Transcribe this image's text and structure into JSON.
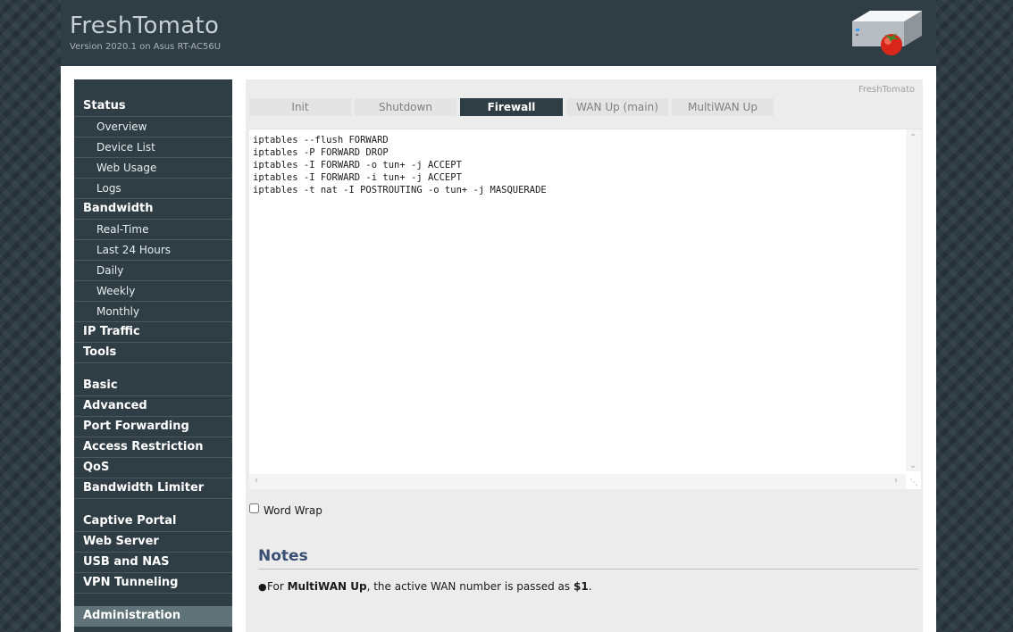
{
  "header": {
    "title": "FreshTomato",
    "version": "Version 2020.1 on Asus RT-AC56U"
  },
  "sidebar": {
    "items": [
      {
        "label": "Status",
        "type": "main"
      },
      {
        "label": "Overview",
        "type": "sub"
      },
      {
        "label": "Device List",
        "type": "sub"
      },
      {
        "label": "Web Usage",
        "type": "sub"
      },
      {
        "label": "Logs",
        "type": "sub"
      },
      {
        "label": "Bandwidth",
        "type": "main"
      },
      {
        "label": "Real-Time",
        "type": "sub"
      },
      {
        "label": "Last 24 Hours",
        "type": "sub"
      },
      {
        "label": "Daily",
        "type": "sub"
      },
      {
        "label": "Weekly",
        "type": "sub"
      },
      {
        "label": "Monthly",
        "type": "sub"
      },
      {
        "label": "IP Traffic",
        "type": "main"
      },
      {
        "label": "Tools",
        "type": "main"
      },
      {
        "label": "Basic",
        "type": "main"
      },
      {
        "label": "Advanced",
        "type": "main"
      },
      {
        "label": "Port Forwarding",
        "type": "main"
      },
      {
        "label": "Access Restriction",
        "type": "main"
      },
      {
        "label": "QoS",
        "type": "main"
      },
      {
        "label": "Bandwidth Limiter",
        "type": "main"
      },
      {
        "label": "Captive Portal",
        "type": "main"
      },
      {
        "label": "Web Server",
        "type": "main"
      },
      {
        "label": "USB and NAS",
        "type": "main"
      },
      {
        "label": "VPN Tunneling",
        "type": "main"
      },
      {
        "label": "Administration",
        "type": "main",
        "active": true
      }
    ]
  },
  "content": {
    "brand": "FreshTomato",
    "tabs": [
      {
        "label": "Init"
      },
      {
        "label": "Shutdown"
      },
      {
        "label": "Firewall",
        "active": true
      },
      {
        "label": "WAN Up (main)"
      },
      {
        "label": "MultiWAN Up"
      }
    ],
    "script": "iptables --flush FORWARD\niptables -P FORWARD DROP\niptables -I FORWARD -o tun+ -j ACCEPT\niptables -I FORWARD -i tun+ -j ACCEPT\niptables -t nat -I POSTROUTING -o tun+ -j MASQUERADE",
    "word_wrap_label": "Word Wrap",
    "word_wrap_checked": false
  },
  "notes": {
    "title": "Notes",
    "items": [
      {
        "prefix": "For ",
        "bold_1": "MultiWAN Up",
        "middle": ", the active WAN number is passed as ",
        "bold_2": "$1",
        "suffix": "."
      }
    ]
  },
  "colors": {
    "header_bg": "#2f3d44",
    "active_tab": "#2f3d44",
    "notes_title": "#3a4d72",
    "sidebar_active": "#5f7379"
  },
  "icons": {
    "router": "router-with-tomato-icon",
    "bullet": "bullet-icon"
  }
}
